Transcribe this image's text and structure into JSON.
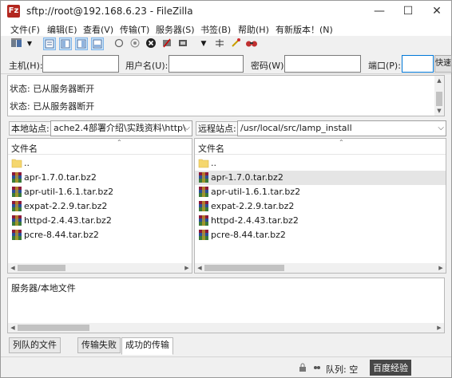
{
  "window": {
    "title": "sftp://root@192.168.6.23 - FileZilla",
    "app_icon_glyph": "Fz",
    "minimize_glyph": "—",
    "maximize_glyph": "☐",
    "close_glyph": "✕"
  },
  "menu": [
    "文件(F)",
    "编辑(E)",
    "查看(V)",
    "传输(T)",
    "服务器(S)",
    "书签(B)",
    "帮助(H)",
    "有新版本！(N)"
  ],
  "toolbar": {
    "icons": [
      "site-manager-icon",
      "dropdown-icon",
      "toggle-log-icon",
      "toggle-local-tree-icon",
      "toggle-remote-tree-icon",
      "toggle-queue-icon",
      "refresh-icon",
      "process-queue-icon",
      "cancel-icon",
      "disconnect-icon",
      "reconnect-icon",
      "filter-icon",
      "compare-icon",
      "sync-browse-icon",
      "search-icon"
    ]
  },
  "quickconnect": {
    "host_label": "主机(H):",
    "host_value": "",
    "user_label": "用户名(U):",
    "user_value": "",
    "pass_label": "密码(W):",
    "pass_value": "",
    "port_label": "端口(P):",
    "port_value": "",
    "button_label": "快速连接(Q)"
  },
  "log": {
    "lines": [
      "状态:  已从服务器断开",
      "状态:  已从服务器断开"
    ]
  },
  "local": {
    "label": "本地站点:",
    "path": "ache2.4部署介绍\\实践资料\\http\\",
    "column": "文件名",
    "files": [
      "..",
      "apr-1.7.0.tar.bz2",
      "apr-util-1.6.1.tar.bz2",
      "expat-2.2.9.tar.bz2",
      "httpd-2.4.43.tar.bz2",
      "pcre-8.44.tar.bz2"
    ]
  },
  "remote": {
    "label": "远程站点:",
    "path": "/usr/local/src/lamp_install",
    "column": "文件名",
    "files": [
      "..",
      "apr-1.7.0.tar.bz2",
      "apr-util-1.6.1.tar.bz2",
      "expat-2.2.9.tar.bz2",
      "httpd-2.4.43.tar.bz2",
      "pcre-8.44.tar.bz2"
    ],
    "selected_index": 1
  },
  "queue": {
    "header": "服务器/本地文件"
  },
  "tabs": [
    "列队的文件",
    "传输失败",
    "成功的传输"
  ],
  "active_tab": 2,
  "status": {
    "queue_text": "队列: 空",
    "watermark": "百度经验"
  },
  "colors": {
    "archive_icon": "#8b1a3a",
    "folder_icon": "#f5d76e",
    "selected_row": "#e5e5e5"
  }
}
